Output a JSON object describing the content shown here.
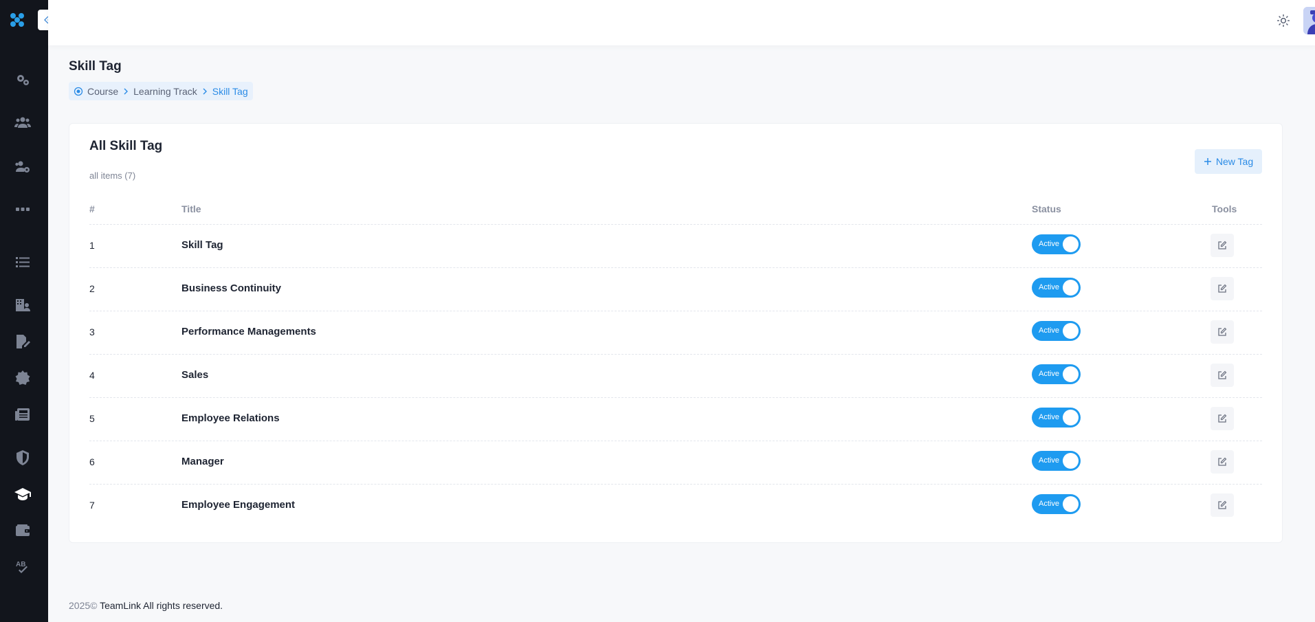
{
  "sidebar": {
    "items": [
      {
        "icon": "gears-icon",
        "name": "sidebar-item-settings"
      },
      {
        "icon": "users-icon",
        "name": "sidebar-item-users"
      },
      {
        "icon": "user-gear-icon",
        "name": "sidebar-item-user-settings"
      },
      {
        "icon": "grid-icon",
        "name": "sidebar-item-apps"
      },
      {
        "icon": "list-icon",
        "name": "sidebar-item-list"
      },
      {
        "icon": "building-user-icon",
        "name": "sidebar-item-organization"
      },
      {
        "icon": "file-signature-icon",
        "name": "sidebar-item-documents"
      },
      {
        "icon": "certificate-icon",
        "name": "sidebar-item-certificate"
      },
      {
        "icon": "newspaper-icon",
        "name": "sidebar-item-news"
      },
      {
        "icon": "shield-icon",
        "name": "sidebar-item-security"
      },
      {
        "icon": "graduation-cap-icon",
        "name": "sidebar-item-course"
      },
      {
        "icon": "wallet-icon",
        "name": "sidebar-item-wallet"
      },
      {
        "icon": "spell-check-icon",
        "name": "sidebar-item-spellcheck"
      }
    ]
  },
  "page": {
    "title": "Skill Tag",
    "breadcrumb": [
      "Course",
      "Learning Track",
      "Skill Tag"
    ]
  },
  "card": {
    "title": "All Skill Tag",
    "subtitle": "all items (7)",
    "new_button": "New Tag"
  },
  "table": {
    "headers": {
      "num": "#",
      "title": "Title",
      "status": "Status",
      "tools": "Tools"
    },
    "rows": [
      {
        "num": "1",
        "title": "Skill Tag",
        "status": "Active"
      },
      {
        "num": "2",
        "title": "Business Continuity",
        "status": "Active"
      },
      {
        "num": "3",
        "title": "Performance Managements",
        "status": "Active"
      },
      {
        "num": "4",
        "title": "Sales",
        "status": "Active"
      },
      {
        "num": "5",
        "title": "Employee Relations",
        "status": "Active"
      },
      {
        "num": "6",
        "title": "Manager",
        "status": "Active"
      },
      {
        "num": "7",
        "title": "Employee Engagement",
        "status": "Active"
      }
    ]
  },
  "footer": {
    "year": "2025©",
    "text": "TeamLink All rights reserved."
  },
  "colors": {
    "accent": "#1e9bf0",
    "sidebar_bg": "#12151c",
    "breadcrumb_bg": "#e8f1fc"
  }
}
